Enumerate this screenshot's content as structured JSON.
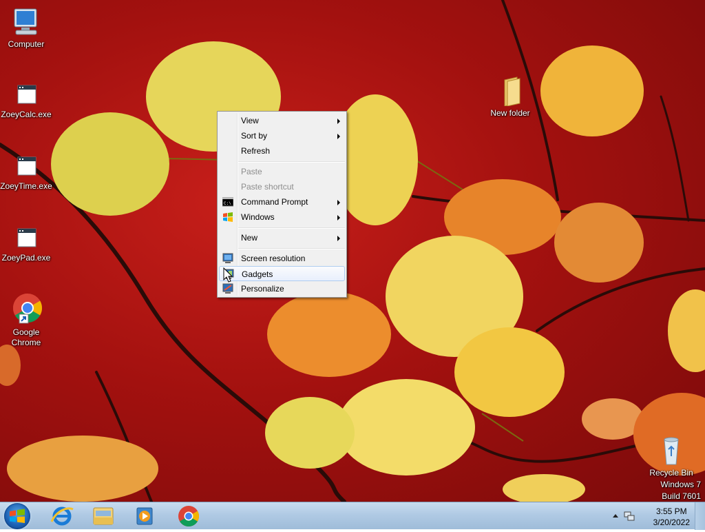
{
  "desktop": {
    "icons": [
      {
        "name": "computer",
        "label": "Computer"
      },
      {
        "name": "zoeycalc",
        "label": "ZoeyCalc.exe"
      },
      {
        "name": "zoeytime",
        "label": "ZoeyTime.exe"
      },
      {
        "name": "zoeypad",
        "label": "ZoeyPad.exe"
      },
      {
        "name": "google-chrome",
        "label": "Google Chrome"
      },
      {
        "name": "new-folder",
        "label": "New folder"
      },
      {
        "name": "recycle-bin",
        "label": "Recycle Bin"
      }
    ],
    "watermark": {
      "line1": "Windows 7",
      "line2": "Build 7601"
    }
  },
  "context_menu": {
    "items": [
      {
        "label": "View",
        "submenu": true,
        "enabled": true
      },
      {
        "label": "Sort by",
        "submenu": true,
        "enabled": true
      },
      {
        "label": "Refresh",
        "submenu": false,
        "enabled": true
      },
      {
        "label": "Paste",
        "submenu": false,
        "enabled": false
      },
      {
        "label": "Paste shortcut",
        "submenu": false,
        "enabled": false
      },
      {
        "label": "Command Prompt",
        "submenu": true,
        "enabled": true,
        "icon": "command-prompt-icon"
      },
      {
        "label": "Windows",
        "submenu": true,
        "enabled": true,
        "icon": "windows-flag-icon"
      },
      {
        "label": "New",
        "submenu": true,
        "enabled": true
      },
      {
        "label": "Screen resolution",
        "submenu": false,
        "enabled": true,
        "icon": "monitor-icon"
      },
      {
        "label": "Gadgets",
        "submenu": false,
        "enabled": true,
        "icon": "gadgets-icon",
        "highlighted": true
      },
      {
        "label": "Personalize",
        "submenu": false,
        "enabled": true,
        "icon": "personalize-icon"
      }
    ]
  },
  "taskbar": {
    "pinned": [
      "internet-explorer-icon",
      "windows-explorer-icon",
      "media-player-icon",
      "chrome-icon"
    ],
    "clock": {
      "time": "3:55 PM",
      "date": "3/20/2022"
    },
    "tray_icons": [
      "show-hidden-icons-icon",
      "network-icon"
    ]
  },
  "colors": {
    "wallpaper": "#b0140f",
    "taskbar": "#b7cfe6",
    "menu_bg": "#f0f0f0",
    "highlight_border": "#aeccf0"
  }
}
